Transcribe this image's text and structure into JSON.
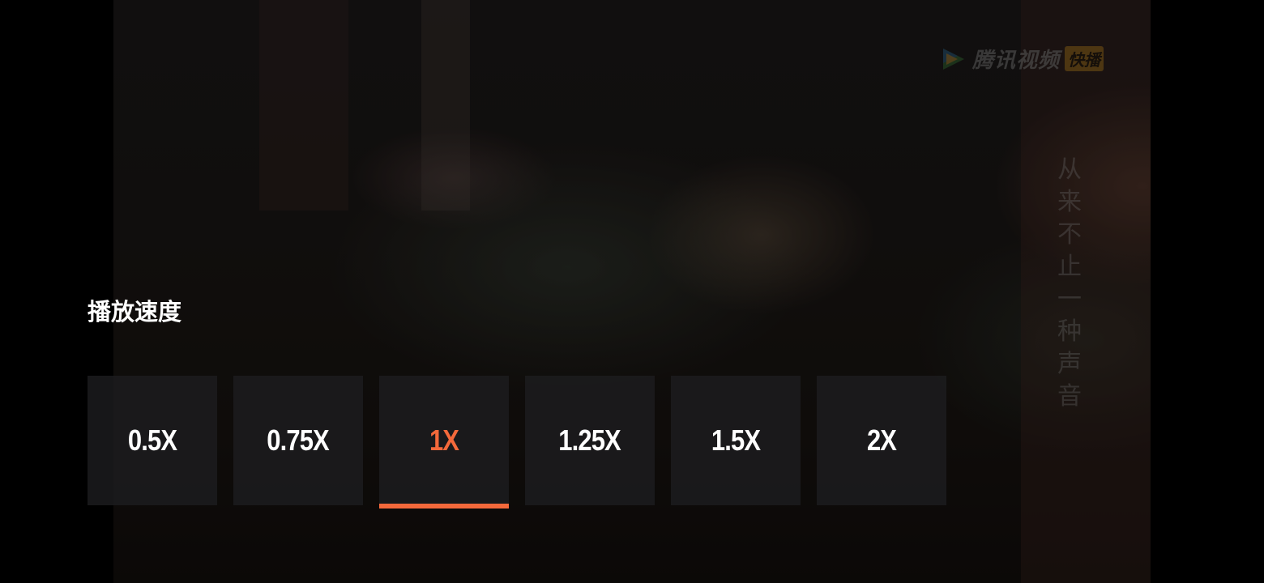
{
  "panel": {
    "title": "播放速度",
    "options": [
      {
        "label": "0.5X",
        "selected": false
      },
      {
        "label": "0.75X",
        "selected": false
      },
      {
        "label": "1X",
        "selected": true
      },
      {
        "label": "1.25X",
        "selected": false
      },
      {
        "label": "1.5X",
        "selected": false
      },
      {
        "label": "2X",
        "selected": false
      }
    ]
  },
  "video": {
    "watermark_text": "腾讯视频",
    "watermark_tag": "快播",
    "vertical_caption": "从来不止一种声音"
  },
  "colors": {
    "accent": "#f4693b",
    "option_bg": "#1e1e20",
    "text": "#ffffff"
  }
}
